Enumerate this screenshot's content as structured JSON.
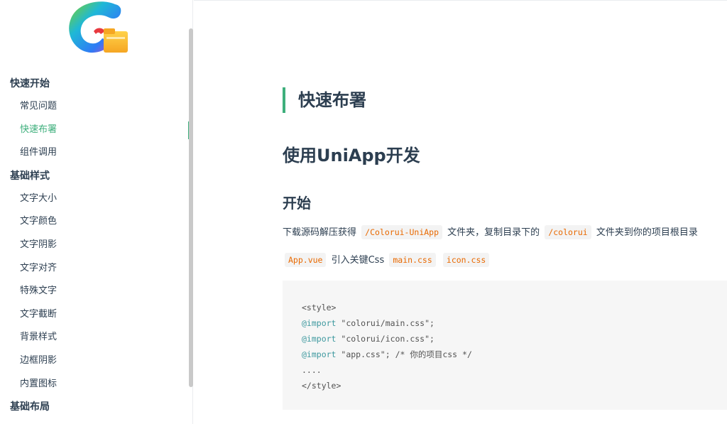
{
  "sidebar": {
    "logo": "colorui-logo",
    "groups": [
      {
        "label": "快速开始",
        "items": [
          {
            "label": "常见问题",
            "active": false
          },
          {
            "label": "快速布署",
            "active": true
          },
          {
            "label": "组件调用",
            "active": false
          }
        ]
      },
      {
        "label": "基础样式",
        "items": [
          {
            "label": "文字大小",
            "active": false
          },
          {
            "label": "文字颜色",
            "active": false
          },
          {
            "label": "文字阴影",
            "active": false
          },
          {
            "label": "文字对齐",
            "active": false
          },
          {
            "label": "特殊文字",
            "active": false
          },
          {
            "label": "文字截断",
            "active": false
          },
          {
            "label": "背景样式",
            "active": false
          },
          {
            "label": "边框阴影",
            "active": false
          },
          {
            "label": "内置图标",
            "active": false
          }
        ]
      },
      {
        "label": "基础布局",
        "items": []
      }
    ]
  },
  "content": {
    "title": "快速布署",
    "subtitle": "使用UniApp开发",
    "section": "开始",
    "para1": {
      "t1": "下载源码解压获得",
      "c1": "/Colorui-UniApp",
      "t2": "文件夹，复制目录下的",
      "c2": "/colorui",
      "t3": "文件夹到你的项目根目录"
    },
    "para2": {
      "c1": "App.vue",
      "t1": "引入关键Css",
      "c2": "main.css",
      "c3": "icon.css"
    },
    "code": {
      "l1": "<style>",
      "l2_kw": "@import",
      "l2_str": " \"colorui/main.css\";",
      "l3_kw": "@import",
      "l3_str": " \"colorui/icon.css\";",
      "l4_kw": "@import",
      "l4_str": " \"app.css\"; ",
      "l4_cm": "/* 你的项目css */",
      "l5": "....",
      "l6": "</style>"
    }
  },
  "colors": {
    "accent": "#3eaf7c",
    "inline_code": "#e96900",
    "text": "#2c3e50"
  }
}
